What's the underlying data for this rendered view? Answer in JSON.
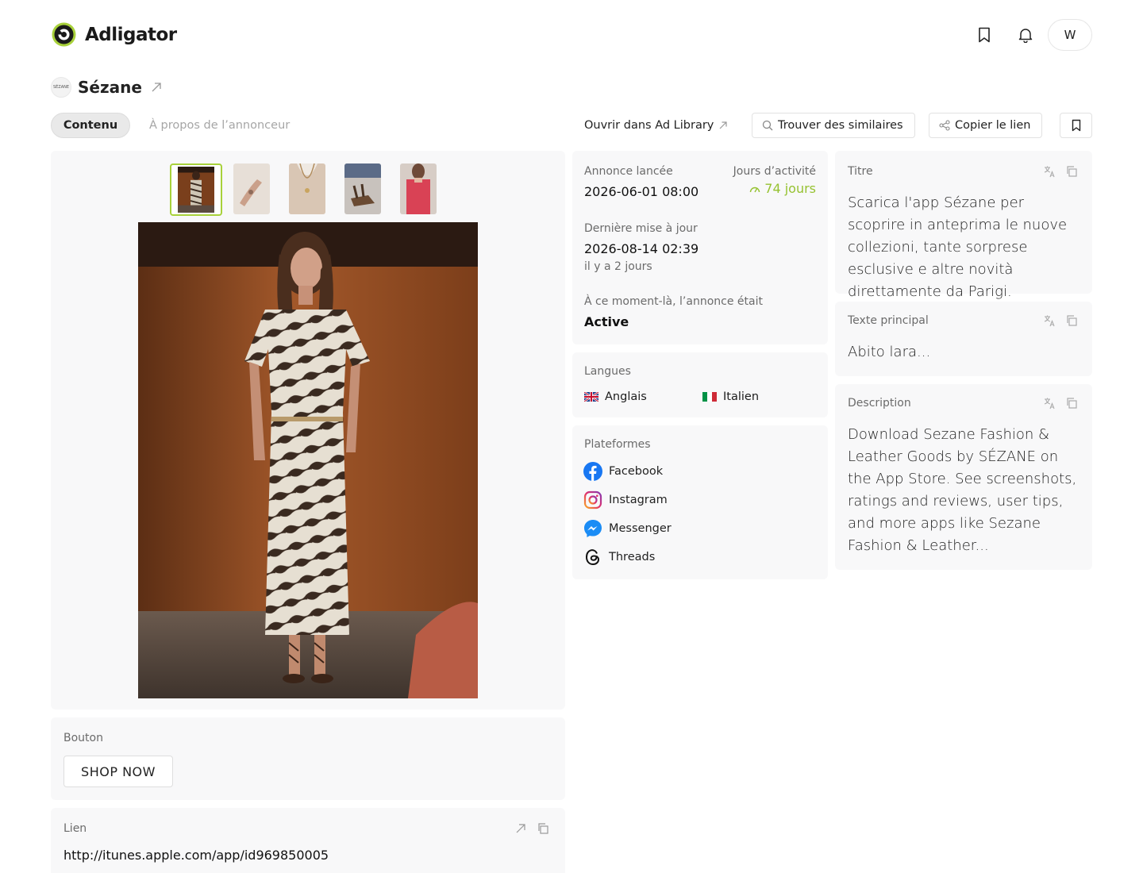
{
  "header": {
    "app_name": "Adligator",
    "bookmark_icon": "bookmark-icon",
    "bell_icon": "bell-icon",
    "avatar_initial": "W"
  },
  "advertiser": {
    "name": "Sézane",
    "logo_text": "SÉZANE"
  },
  "tabs": {
    "content": "Contenu",
    "about": "À propos de l’annonceur"
  },
  "actions": {
    "open_library": "Ouvrir dans Ad Library",
    "find_similar": "Trouver des similaires",
    "copy_link": "Copier le lien"
  },
  "ad_info": {
    "launched_label": "Annonce lancée",
    "launched_value": "2026-06-01 08:00",
    "active_days_label": "Jours d’activité",
    "active_days_value": "74 jours",
    "updated_label": "Dernière mise à jour",
    "updated_value": "2026-08-14 02:39",
    "updated_relative": "il y a 2 jours",
    "status_label": "À ce moment-là, l’annonce était",
    "status_value": "Active"
  },
  "languages": {
    "label": "Langues",
    "items": [
      "Anglais",
      "Italien"
    ]
  },
  "platforms": {
    "label": "Plateformes",
    "items": [
      "Facebook",
      "Instagram",
      "Messenger",
      "Threads"
    ]
  },
  "title_block": {
    "label": "Titre",
    "text": "Scarica l'app Sézane per scoprire in anteprima le nuove collezioni, tante sorprese esclusive e altre novità direttamente da Parigi."
  },
  "main_text": {
    "label": "Texte principal",
    "text": "Abito lara..."
  },
  "description": {
    "label": "Description",
    "text": "Download Sezane Fashion & Leather Goods by SÉZANE on the App Store. See screenshots, ratings and reviews, user tips, and more apps like Sezane Fashion & Leather..."
  },
  "cta": {
    "label": "Bouton",
    "button": "SHOP NOW"
  },
  "link": {
    "label": "Lien",
    "url": "http://itunes.apple.com/app/id969850005"
  },
  "colors": {
    "accent_green": "#a8d13b",
    "panel_bg": "#f8f8f9"
  }
}
